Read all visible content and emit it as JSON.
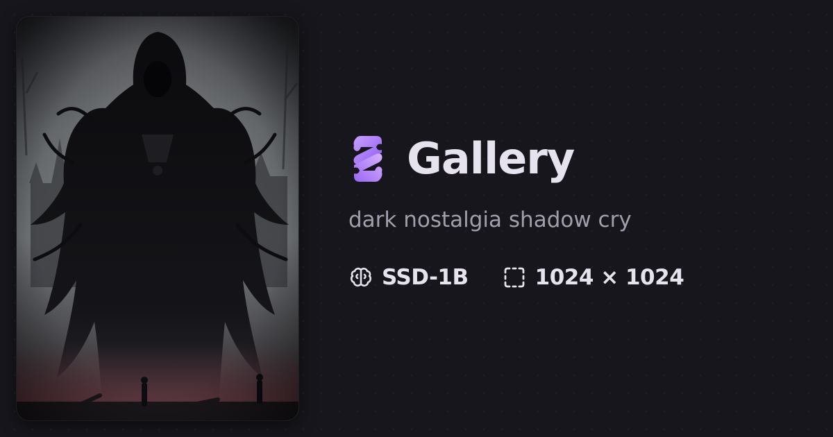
{
  "card": {
    "image_alt": "dark hooded shadow figure artwork",
    "palette": {
      "sky_top": "#2b2c31",
      "sky_mid": "#6c6f72",
      "sky_glow": "#9b9ea0",
      "ground": "#1a171a",
      "ember": "#6e3c44",
      "figure": "#0c0c0f"
    }
  },
  "brand": {
    "title": "Gallery",
    "logo_icon": "puzzle-s-logo-icon",
    "logo_colors": [
      "#c9a0ff",
      "#8f5cf0",
      "#b07cf7"
    ]
  },
  "prompt": {
    "text": "dark nostalgia shadow cry"
  },
  "meta": {
    "model": {
      "icon": "brain-icon",
      "label": "SSD-1B"
    },
    "size": {
      "icon": "dashed-square-icon",
      "label": "1024 × 1024"
    }
  },
  "colors": {
    "background": "#17161c",
    "title": "#e6e3ee",
    "subtitle": "#a19fab"
  }
}
